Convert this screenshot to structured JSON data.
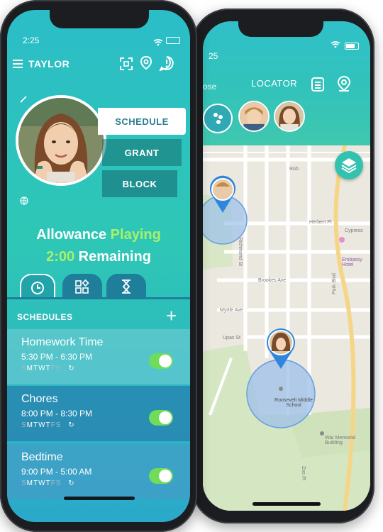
{
  "front": {
    "status_time": "2:25",
    "title": "TAYLOR",
    "buttons": {
      "schedule": "SCHEDULE",
      "grant": "GRANT",
      "block": "BLOCK"
    },
    "allowance": {
      "word": "Allowance",
      "status": "Playing",
      "time": "2:00",
      "remaining": "Remaining"
    },
    "schedules_label": "SCHEDULES",
    "schedules": [
      {
        "title": "Homework Time",
        "time": "5:30 PM - 6:30 PM",
        "enabled": true
      },
      {
        "title": "Chores",
        "time": "8:00 PM - 8:30 PM",
        "enabled": true
      },
      {
        "title": "Bedtime",
        "time": "9:00 PM - 5:00 AM",
        "enabled": true
      }
    ],
    "days": [
      "S",
      "M",
      "T",
      "W",
      "T",
      "F",
      "S"
    ]
  },
  "back": {
    "status_time": "25",
    "title": "LOCATOR",
    "close_label": "ose",
    "map": {
      "streets": [
        "Herbert Pl",
        "Cypress",
        "Brookes Ave",
        "Myrtle Ave",
        "Upas St",
        "Richmond St",
        "Park Blvd",
        "Zoo Pl"
      ],
      "poi": [
        "Embassy Hotel",
        "Roosevelt Middle School",
        "War Memorial Building"
      ],
      "street_top": "Rob"
    }
  },
  "colors": {
    "accent_green": "#a9f06b",
    "teal": "#2fc0c9",
    "toggle_on": "#6fdc5a"
  }
}
